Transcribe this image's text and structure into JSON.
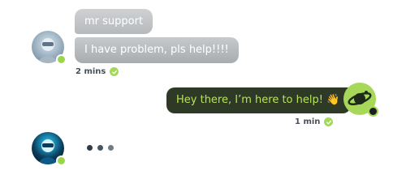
{
  "messages": {
    "support_name": "mr support",
    "user_message": "I have problem, pls help!!!!",
    "user_time": "2 mins",
    "reply_message": "Hey there, I’m here to help! 👋",
    "reply_time": "1 min"
  },
  "colors": {
    "status_online": "#9bd64a",
    "reply_bubble": "#2e3a25",
    "reply_text": "#b6e35a",
    "check": "#a2d957"
  },
  "icons": {
    "support_avatar": "robot-avatar-icon",
    "agent_avatar": "planet-icon",
    "read_check": "check-icon"
  }
}
